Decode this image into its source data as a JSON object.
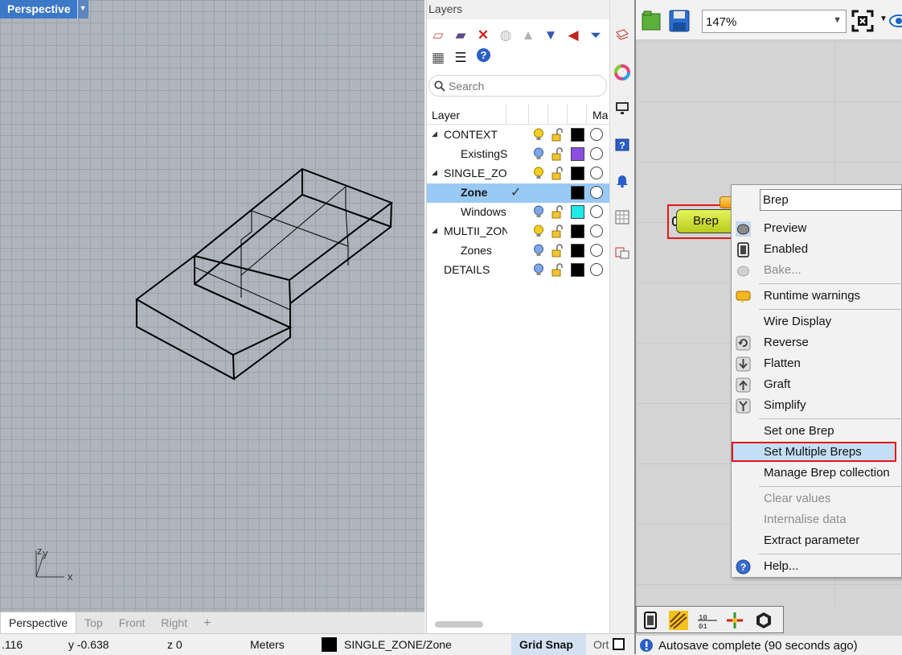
{
  "viewport": {
    "title": "Perspective",
    "axis_x": "x",
    "axis_y": "y",
    "axis_z": "z",
    "tabs": [
      "Perspective",
      "Top",
      "Front",
      "Right"
    ],
    "add_tab": "+"
  },
  "layers": {
    "panel_title": "Layers",
    "search_placeholder": "Search",
    "col_layer": "Layer",
    "col_material": "Ma",
    "rows": [
      {
        "name": "CONTEXT",
        "expander": "◢",
        "color": "#000000"
      },
      {
        "name": "ExistingS",
        "color": "#8a4fe0"
      },
      {
        "name": "SINGLE_ZON",
        "expander": "◢",
        "color": "#000000"
      },
      {
        "name": "Zone",
        "color": "#000000",
        "current": "✓"
      },
      {
        "name": "Windows",
        "color": "#1fe8e8"
      },
      {
        "name": "MULTII_ZON",
        "expander": "◢",
        "color": "#000000"
      },
      {
        "name": "Zones",
        "color": "#000000"
      },
      {
        "name": "DETAILS",
        "color": "#000000"
      }
    ]
  },
  "grasshopper": {
    "zoom": "147%",
    "node_label": "Brep",
    "menu": {
      "name_field": "Brep",
      "items": [
        {
          "label": "Preview",
          "enabled": true
        },
        {
          "label": "Enabled",
          "enabled": true
        },
        {
          "label": "Bake...",
          "enabled": false
        },
        {
          "label": "Runtime warnings",
          "enabled": true
        },
        {
          "label": "Wire Display",
          "enabled": true
        },
        {
          "label": "Reverse",
          "enabled": true
        },
        {
          "label": "Flatten",
          "enabled": true
        },
        {
          "label": "Graft",
          "enabled": true
        },
        {
          "label": "Simplify",
          "enabled": true
        },
        {
          "label": "Set one Brep",
          "enabled": true
        },
        {
          "label": "Set Multiple Breps",
          "enabled": true,
          "highlighted": true
        },
        {
          "label": "Manage Brep collection",
          "enabled": true
        },
        {
          "label": "Clear values",
          "enabled": false
        },
        {
          "label": "Internalise data",
          "enabled": false
        },
        {
          "label": "Extract parameter",
          "enabled": true
        },
        {
          "label": "Help...",
          "enabled": true
        }
      ]
    },
    "status": "Autosave complete (90 seconds ago)"
  },
  "statusbar": {
    "x": ".116",
    "y": "y -0.638",
    "z": "z 0",
    "units": "Meters",
    "layer": "SINGLE_ZONE/Zone",
    "grid_snap": "Grid Snap",
    "ortho": "Ort"
  },
  "colors": {
    "accent": "#3b78c8",
    "selection": "#99c9f5",
    "highlight_border": "#e1161c",
    "node_fill": "#d4e33b"
  }
}
